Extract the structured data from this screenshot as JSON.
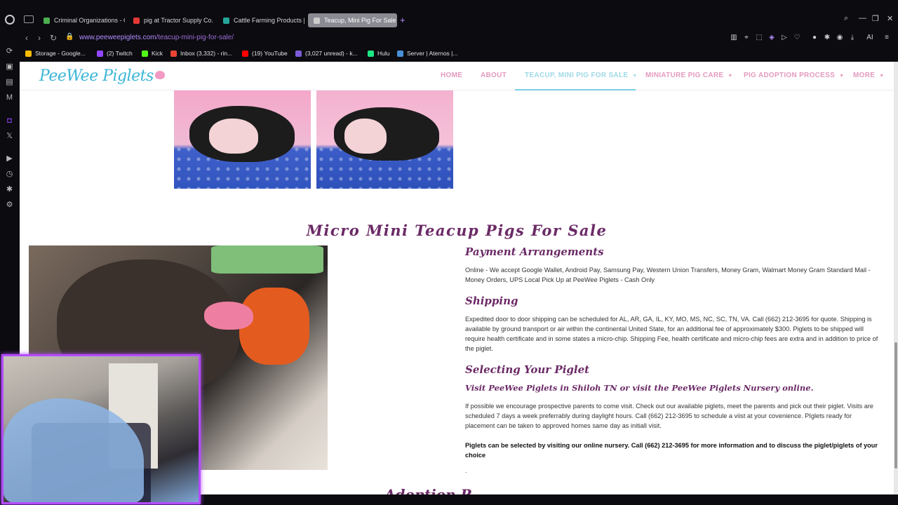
{
  "tabs": [
    {
      "label": "Criminal Organizations - G",
      "color": "#4caf50"
    },
    {
      "label": "pig at Tractor Supply Co.",
      "color": "#e53935"
    },
    {
      "label": "Cattle Farming Products |",
      "color": "#26a69a"
    },
    {
      "label": "Teacup, Mini Pig For Sale",
      "color": "#cccccc",
      "active": true
    }
  ],
  "address": {
    "host": "www.peeweepiglets.com",
    "path": "/teacup-mini-pig-for-sale/"
  },
  "bookmarks": [
    {
      "label": "Storage - Google...",
      "color": "#fbbc04"
    },
    {
      "label": "(2) Twitch",
      "color": "#9146ff"
    },
    {
      "label": "Kick",
      "color": "#53fc18"
    },
    {
      "label": "Inbox (3,332) - rin...",
      "color": "#ea4335"
    },
    {
      "label": "(19) YouTube",
      "color": "#ff0000"
    },
    {
      "label": "(3,027 unread) - k...",
      "color": "#7b5cd6"
    },
    {
      "label": "Hulu",
      "color": "#1ce783"
    },
    {
      "label": "Server | Aternos |...",
      "color": "#4a90d9"
    }
  ],
  "site": {
    "logo": "PeeWee Piglets",
    "menu": [
      "HOME",
      "ABOUT",
      "TEACUP, MINI PIG FOR SALE",
      "MINIATURE PIG CARE",
      "PIG ADOPTION PROCESS",
      "MORE"
    ]
  },
  "main": {
    "section_title": "Micro Mini Teacup Pigs For Sale",
    "payment_heading": "Payment Arrangements",
    "payment_text": "Online - We accept Google Wallet, Android Pay, Samsung Pay, Western Union Transfers, Money Gram, Walmart Money Gram Standard Mail - Money Orders, UPS Local Pick Up at PeeWee Piglets - Cash Only",
    "shipping_heading": "Shipping",
    "shipping_text": "Expedited door to door shipping can be scheduled for AL, AR, GA, IL, KY, MO, MS, NC, SC, TN, VA. Call (662) 212-3695 for quote. Shipping is available by ground transport or air within the continental United State, for an additional fee of approximately $300. Piglets to be shipped will require health certificate and in some states a micro-chip. Shipping Fee, health certificate and micro-chip fees are extra and in addition to price of the piglet.",
    "selecting_heading": "Selecting Your Piglet",
    "selecting_sub": "Visit PeeWee Piglets in Shiloh TN or visit the PeeWee Piglets Nursery online.",
    "selecting_text": "If possible we encourage prospective parents to come visit. Check out our available piglets, meet the parents and pick out their piglet. Visits are scheduled 7 days a week preferrably during daylight hours. Call (662) 212-3695 to schedule a viist at your covenience. PIglets ready for placement can be taken to approved homes same day as initiall visit.",
    "selecting_bold": "Piglets can be selected by visiting our online nursery. Call (662) 212-3695 for more information and to discuss the piglet/piglets of your choice",
    "dot": ".",
    "bottom_partial": "Adoption P"
  },
  "colors": {
    "accent": "#b44cff",
    "heading": "#6b2a66",
    "menu": "#e39abf",
    "menu_active": "#9fd9e6"
  }
}
